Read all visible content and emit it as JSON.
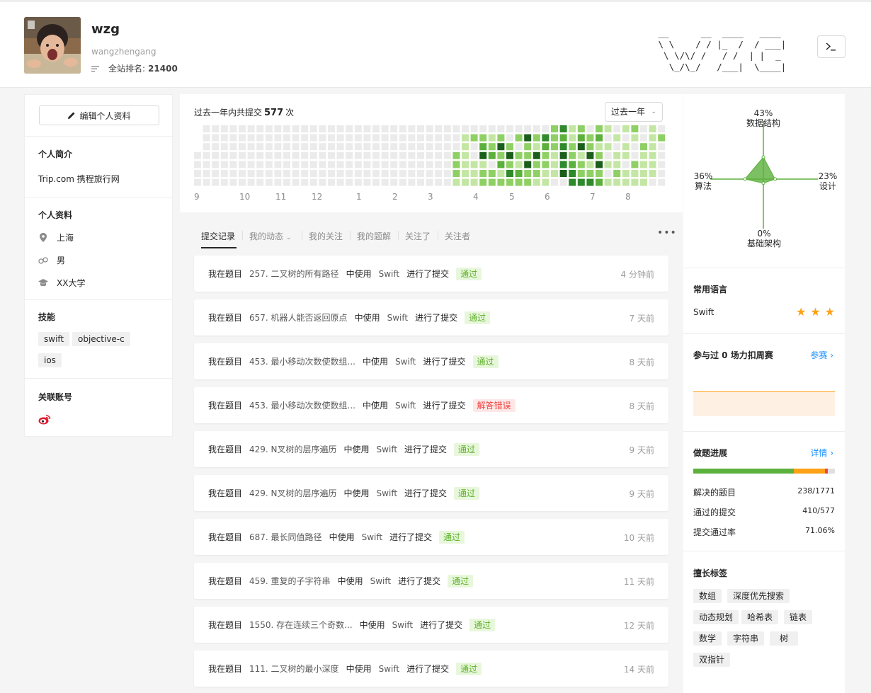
{
  "profile": {
    "name": "wzg",
    "login": "wangzhengang",
    "rank_label": "全站排名:",
    "rank_value": "21400",
    "ascii_logo": [
      " __      __  ____   ____ ",
      " \\ \\    / / |_  /  / ___|",
      "  \\ \\/\\/ /   / /  | |  _ ",
      "   \\_/\\_/   /___|  \\____|"
    ]
  },
  "left": {
    "edit_label": "编辑个人资料",
    "intro_title": "个人简介",
    "intro_text": "Trip.com 携程旅行网",
    "info_title": "个人资料",
    "location": "上海",
    "gender": "男",
    "school": "XX大学",
    "skills_title": "技能",
    "skills": [
      "swift",
      "objective-c",
      "ios"
    ],
    "linked_title": "关联账号"
  },
  "calendar": {
    "prefix": "过去一年内共提交",
    "count": "577",
    "suffix": "次",
    "range_label": "过去一年",
    "months": [
      "9",
      "10",
      "11",
      "12",
      "1",
      "2",
      "3",
      "4",
      "5",
      "6",
      "7",
      "8"
    ],
    "legend_colors": [
      "#ebebeb",
      "#c4e6a4",
      "#8fd064",
      "#5cb03c",
      "#2e8a2a",
      "#1b5e1b"
    ]
  },
  "tabs": [
    "提交记录",
    "我的动态",
    "我的关注",
    "我的题解",
    "关注了",
    "关注者"
  ],
  "submissions": [
    {
      "pre": "我在题目",
      "problem": "257. 二叉树的所有路径",
      "use": "中使用",
      "lang": "Swift",
      "did": "进行了提交",
      "status": "通过",
      "ok": true,
      "time": "4 分钟前"
    },
    {
      "pre": "我在题目",
      "problem": "657. 机器人能否返回原点",
      "use": "中使用",
      "lang": "Swift",
      "did": "进行了提交",
      "status": "通过",
      "ok": true,
      "time": "7 天前"
    },
    {
      "pre": "我在题目",
      "problem": "453. 最小移动次数使数组...",
      "use": "中使用",
      "lang": "Swift",
      "did": "进行了提交",
      "status": "通过",
      "ok": true,
      "time": "8 天前"
    },
    {
      "pre": "我在题目",
      "problem": "453. 最小移动次数使数组...",
      "use": "中使用",
      "lang": "Swift",
      "did": "进行了提交",
      "status": "解答错误",
      "ok": false,
      "time": "8 天前"
    },
    {
      "pre": "我在题目",
      "problem": "429. N叉树的层序遍历",
      "use": "中使用",
      "lang": "Swift",
      "did": "进行了提交",
      "status": "通过",
      "ok": true,
      "time": "9 天前"
    },
    {
      "pre": "我在题目",
      "problem": "429. N叉树的层序遍历",
      "use": "中使用",
      "lang": "Swift",
      "did": "进行了提交",
      "status": "通过",
      "ok": true,
      "time": "9 天前"
    },
    {
      "pre": "我在题目",
      "problem": "687. 最长同值路径",
      "use": "中使用",
      "lang": "Swift",
      "did": "进行了提交",
      "status": "通过",
      "ok": true,
      "time": "10 天前"
    },
    {
      "pre": "我在题目",
      "problem": "459. 重复的子字符串",
      "use": "中使用",
      "lang": "Swift",
      "did": "进行了提交",
      "status": "通过",
      "ok": true,
      "time": "11 天前"
    },
    {
      "pre": "我在题目",
      "problem": "1550. 存在连续三个奇数...",
      "use": "中使用",
      "lang": "Swift",
      "did": "进行了提交",
      "status": "通过",
      "ok": true,
      "time": "12 天前"
    },
    {
      "pre": "我在题目",
      "problem": "111. 二叉树的最小深度",
      "use": "中使用",
      "lang": "Swift",
      "did": "进行了提交",
      "status": "通过",
      "ok": true,
      "time": "14 天前"
    }
  ],
  "radar": {
    "top": {
      "pct": "43%",
      "name": "数据结构",
      "value": 43
    },
    "left": {
      "pct": "36%",
      "name": "算法",
      "value": 36
    },
    "right": {
      "pct": "23%",
      "name": "设计",
      "value": 23
    },
    "bottom": {
      "pct": "0%",
      "name": "基础架构",
      "value": 0
    },
    "fill_color": "#5cb03c"
  },
  "languages": {
    "title": "常用语言",
    "name": "Swift",
    "stars": 3,
    "star_color": "#ffa116"
  },
  "contest": {
    "title": "参与过 0 场力扣周赛",
    "link": "参赛",
    "fill_color": "#fef1e4",
    "line_color": "#ffa116"
  },
  "progress": {
    "title": "做题进展",
    "link": "详情",
    "segments": [
      {
        "name": "easy",
        "fraction": 0.71,
        "color": "#5cb03c"
      },
      {
        "name": "medium",
        "fraction": 0.22,
        "color": "#ffa116"
      },
      {
        "name": "hard",
        "fraction": 0.02,
        "color": "#ef4743"
      }
    ],
    "solved_label": "解决的题目",
    "solved_value": "238/1771",
    "accepted_label": "通过的提交",
    "accepted_value": "410/577",
    "rate_label": "提交通过率",
    "rate_value": "71.06%"
  },
  "tags": {
    "title": "擅长标签",
    "items": [
      "数组",
      "深度优先搜索",
      "动态规划",
      "哈希表",
      "链表",
      "数学",
      "字符串",
      "树",
      "双指针"
    ]
  }
}
